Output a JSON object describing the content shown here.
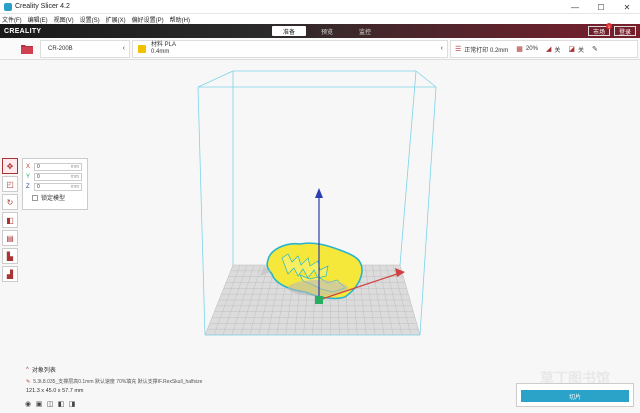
{
  "window": {
    "title": "Creality Slicer 4.2",
    "minimize": "—",
    "maximize": "☐",
    "close": "✕"
  },
  "menu": [
    "文件(F)",
    "编辑(E)",
    "视图(V)",
    "设置(S)",
    "扩展(X)",
    "偏好设置(P)",
    "帮助(H)"
  ],
  "header": {
    "logo": "CREALITY",
    "stages": [
      "准备",
      "预览",
      "监控"
    ],
    "active_stage": "准备",
    "right_buttons": [
      {
        "label": "市场",
        "badge": "1"
      },
      {
        "label": "登录",
        "badge": ""
      }
    ]
  },
  "toolbar": {
    "machine": "CR-200B",
    "material_label": "材料 PLA",
    "nozzle": "0.4mm",
    "profile": "正常打印 0.2mm",
    "infill": "20%",
    "support": "关",
    "adhesion": "关"
  },
  "move_panel": {
    "x": {
      "label": "X",
      "value": "0",
      "unit": "mm"
    },
    "y": {
      "label": "Y",
      "value": "0",
      "unit": "mm"
    },
    "z": {
      "label": "Z",
      "value": "0",
      "unit": "mm"
    },
    "lock_label": "锁定模型"
  },
  "bottom": {
    "object_list_label": "对象列表",
    "object_name": "5.3t.8.035_支撑层高0.1mm 默认速度 70%填充 默认支撑IF.RexSkull_halfsize",
    "dimensions": "121.3 x 45.0 x 57.7 mm",
    "slice_label": "切片"
  },
  "watermark": "草丁图书馆",
  "colors": {
    "accent": "#2ba3c9",
    "brand": "#a33040",
    "model": "#f5e83a",
    "model_outline": "#28b4cf",
    "frame": "#7ed3ea"
  }
}
